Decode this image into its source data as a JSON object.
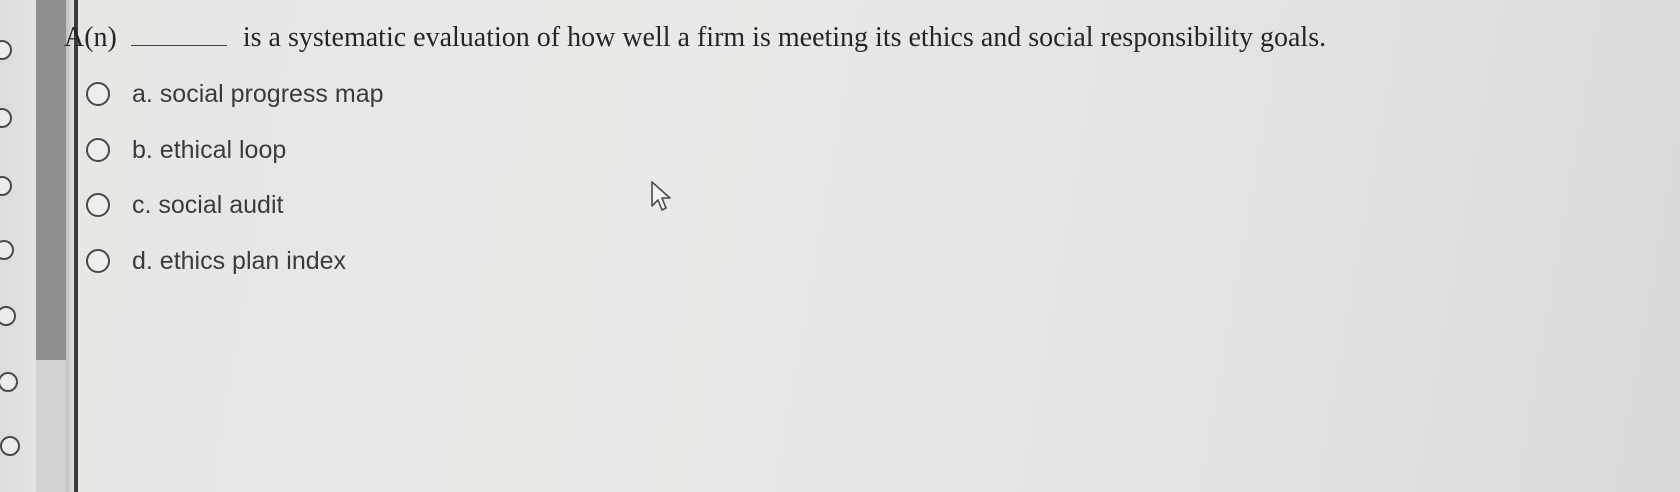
{
  "question": {
    "prefix": "A(n)",
    "text": "is a systematic evaluation of how well a firm is meeting its ethics and social responsibility goals."
  },
  "options": [
    {
      "label": "a. social progress map",
      "selected": false
    },
    {
      "label": "b. ethical loop",
      "selected": false
    },
    {
      "label": "c. social audit",
      "selected": false
    },
    {
      "label": "d. ethics plan index",
      "selected": false
    }
  ],
  "icons": {
    "pointer": "mouse-pointer-icon"
  }
}
